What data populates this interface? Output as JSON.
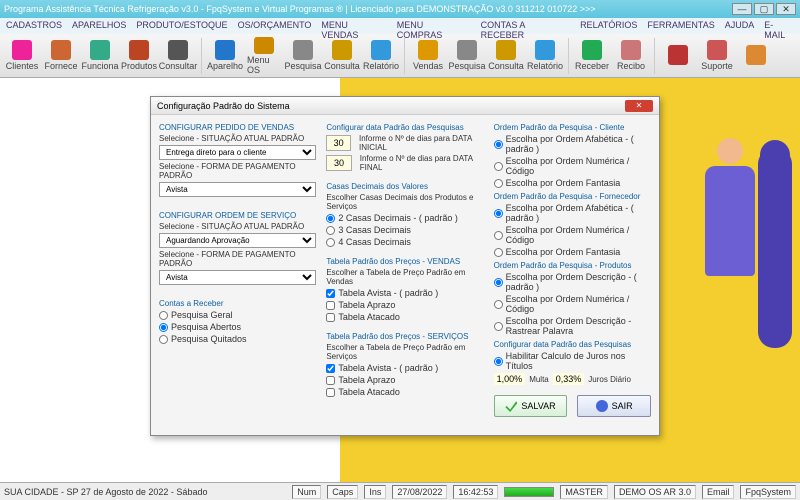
{
  "title": "Programa Assistência Técnica Refrigeração v3.0 - FpqSystem e Virtual Programas ® | Licenciado para  DEMONSTRAÇÃO v3.0 311212 010722 >>>",
  "menu": [
    "CADASTROS",
    "APARELHOS",
    "PRODUTO/ESTOQUE",
    "OS/ORÇAMENTO",
    "MENU VENDAS",
    "MENU COMPRAS",
    "CONTAS A RECEBER",
    "RELATÓRIOS",
    "FERRAMENTAS",
    "AJUDA",
    "E-MAIL"
  ],
  "toolbar": [
    {
      "label": "Clientes",
      "c": "#e29"
    },
    {
      "label": "Fornece",
      "c": "#c63"
    },
    {
      "label": "Funciona",
      "c": "#3a8"
    },
    {
      "label": "Produtos",
      "c": "#b42"
    },
    {
      "label": "Consultar",
      "c": "#555"
    },
    {
      "label": "Aparelho",
      "c": "#27c"
    },
    {
      "label": "Menu OS",
      "c": "#c80"
    },
    {
      "label": "Pesquisa",
      "c": "#888"
    },
    {
      "label": "Consulta",
      "c": "#c90"
    },
    {
      "label": "Relatório",
      "c": "#39d"
    },
    {
      "label": "Vendas",
      "c": "#d90"
    },
    {
      "label": "Pesquisa",
      "c": "#888"
    },
    {
      "label": "Consulta",
      "c": "#c90"
    },
    {
      "label": "Relatório",
      "c": "#39d"
    },
    {
      "label": "Receber",
      "c": "#2a5"
    },
    {
      "label": "Recibo",
      "c": "#c77"
    },
    {
      "label": "",
      "c": "#b33"
    },
    {
      "label": "Suporte",
      "c": "#c55"
    },
    {
      "label": "",
      "c": "#d83"
    }
  ],
  "dialog": {
    "title": "Configuração Padrão do Sistema",
    "col1": {
      "h1": "CONFIGURAR PEDIDO DE VENDAS",
      "l1": "Selecione - SITUAÇÃO ATUAL PADRÃO",
      "v1": "Entrega direto para o cliente",
      "l2": "Selecione - FORMA DE PAGAMENTO PADRÃO",
      "v2": "Avista",
      "h2": "CONFIGURAR ORDEM DE SERVIÇO",
      "l3": "Selecione - SITUAÇÃO ATUAL PADRÃO",
      "v3": "Aguardando Aprovação",
      "l4": "Selecione - FORMA DE PAGAMENTO PADRÃO",
      "v4": "Avista",
      "h3": "Contas a Receber",
      "r1": "Pesquisa Geral",
      "r2": "Pesquisa Abertos",
      "r3": "Pesquisa Quitados"
    },
    "col2": {
      "h1": "Configurar data Padrão das Pesquisas",
      "n1": "30",
      "t1": "Informe o Nº de dias para DATA INICIAL",
      "n2": "30",
      "t2": "Informe o Nº de dias para DATA FINAL",
      "h2": "Casas Decimais dos Valores",
      "l2": "Escolher Casas Decimais dos Produtos e Serviços",
      "r1": "2 Casas Decimais - ( padrão )",
      "r2": "3 Casas Decimais",
      "r3": "4 Casas Decimais",
      "h3": "Tabela Padrão dos Preços - VENDAS",
      "l3": "Escolher a Tabela de Preço Padrão em Vendas",
      "c1": "Tabela Avista - ( padrão )",
      "c2": "Tabela Aprazo",
      "c3": "Tabela Atacado",
      "h4": "Tabela Padrão dos Preços - SERVIÇOS",
      "l4": "Escolher a Tabela de Preço Padrão em Serviços",
      "c4": "Tabela Avista - ( padrão )",
      "c5": "Tabela Aprazo",
      "c6": "Tabela Atacado"
    },
    "col3": {
      "h1": "Ordem Padrão da Pesquisa - Cliente",
      "a1": "Escolha por Ordem Afabética - ( padrão )",
      "a2": "Escolha por Ordem Numérica / Código",
      "a3": "Escolha por Ordem Fantasia",
      "h2": "Ordem Padrão da Pesquisa - Fornecedor",
      "b1": "Escolha por Ordem Afabética - ( padrão )",
      "b2": "Escolha por Ordem Numérica / Código",
      "b3": "Escolha por Ordem Fantasia",
      "h3": "Ordem Padrão da Pesquisa - Produtos",
      "c1": "Escolha por Ordem Descrição - ( padrão )",
      "c2": "Escolha por Ordem Numérica / Código",
      "c3": "Escolha por Ordem Descrição - Rastrear Palavra",
      "h4": "Configurar data Padrão das Pesquisas",
      "d1": "Habilitar Calculo de Juros nos Títulos",
      "jv": "1,00%",
      "jl": "Multa",
      "jv2": "0,33%",
      "jl2": "Juros Diário",
      "save": "SALVAR",
      "exit": "SAIR"
    }
  },
  "status": {
    "loc": "SUA CIDADE - SP 27 de Agosto de 2022 - Sábado",
    "num": "Num",
    "caps": "Caps",
    "ins": "Ins",
    "date": "27/08/2022",
    "time": "16:42:53",
    "user": "MASTER",
    "ver": "DEMO OS AR 3.0",
    "email": "Email",
    "sys": "FpqSystem"
  }
}
